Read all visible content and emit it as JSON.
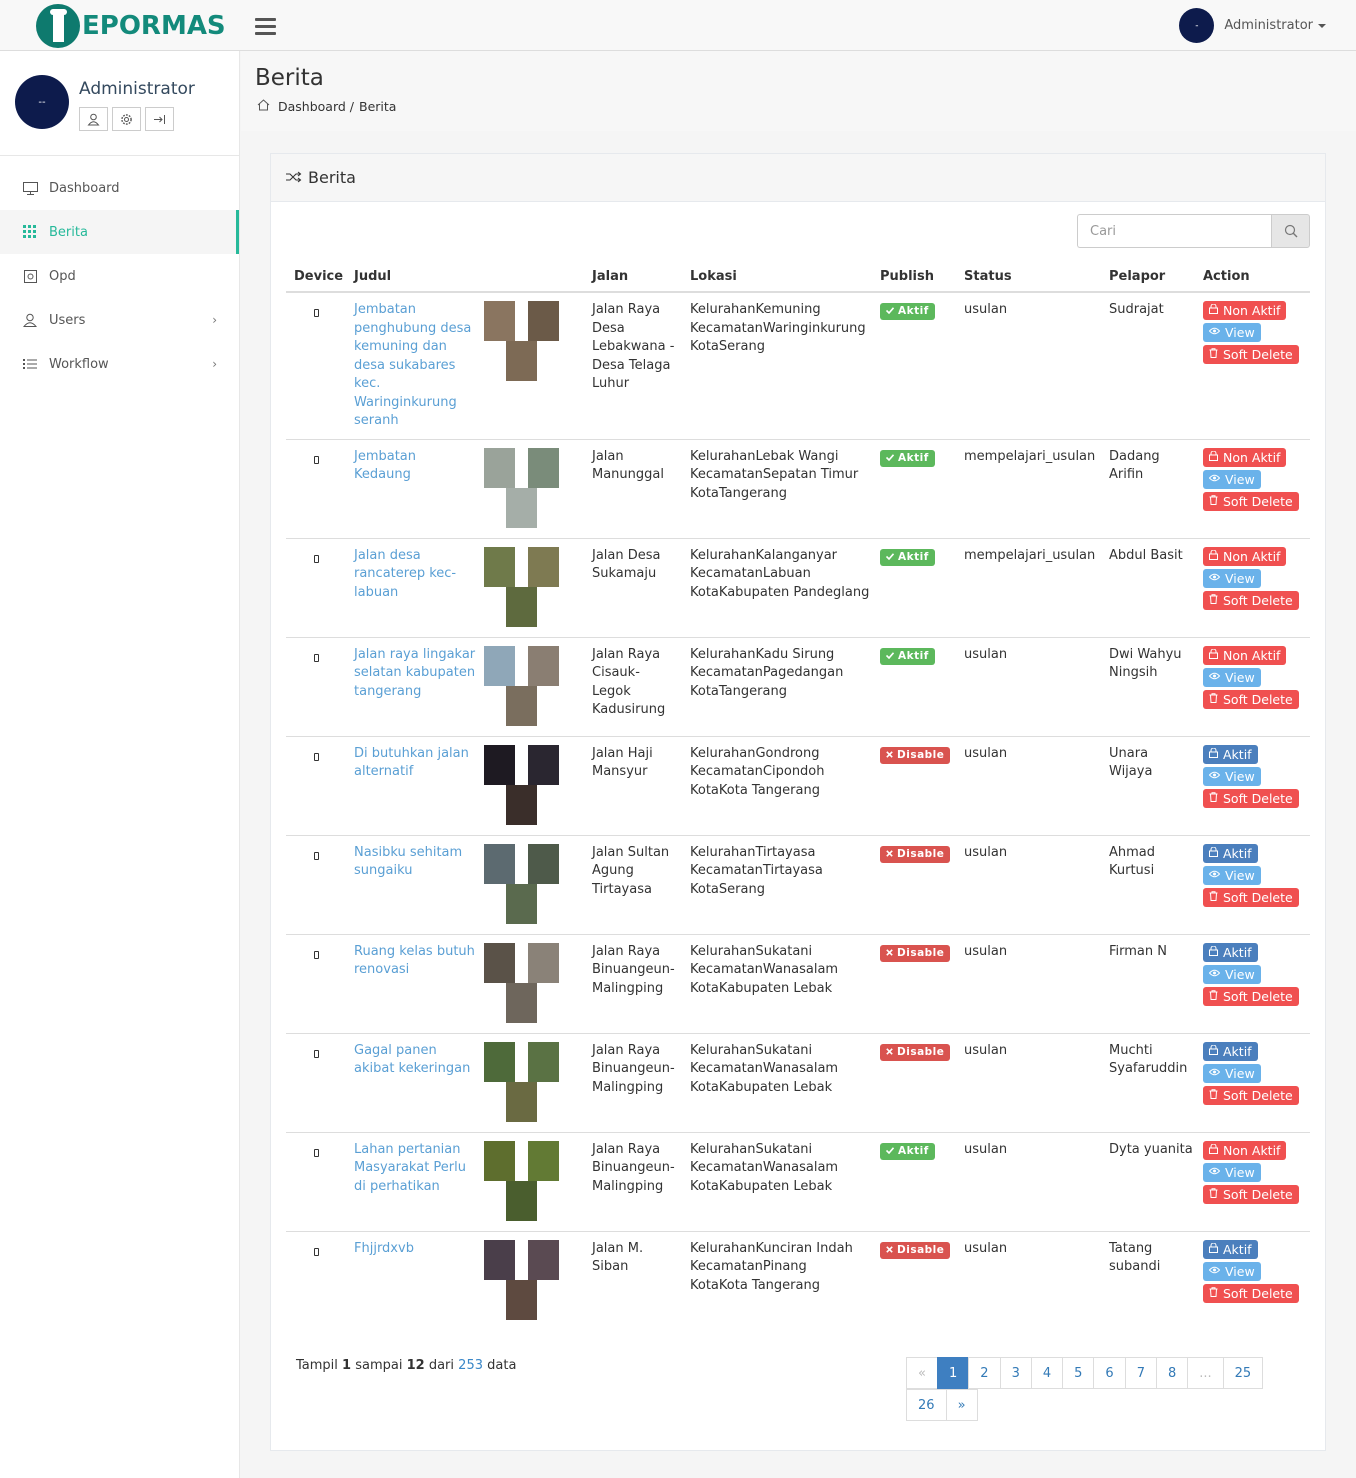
{
  "app": {
    "brand": "EPORMAS",
    "user": "Administrator",
    "avatar_initial": "-"
  },
  "sidebar": {
    "profile_name": "Administrator",
    "avatar_initial": "--",
    "items": [
      {
        "label": "Dashboard",
        "icon": "monitor-icon",
        "active": false
      },
      {
        "label": "Berita",
        "icon": "grid-icon",
        "active": true
      },
      {
        "label": "Opd",
        "icon": "settings-square-icon",
        "active": false
      },
      {
        "label": "Users",
        "icon": "user-icon",
        "active": false,
        "chevron": "›"
      },
      {
        "label": "Workflow",
        "icon": "list-icon",
        "active": false,
        "chevron": "›"
      }
    ]
  },
  "page": {
    "title": "Berita",
    "breadcrumb": [
      "Dashboard /",
      "Berita"
    ]
  },
  "panel": {
    "title": "Berita",
    "search_placeholder": "Cari"
  },
  "table": {
    "headers": [
      "Device",
      "Judul",
      "",
      "Jalan",
      "Lokasi",
      "Publish",
      "Status",
      "Pelapor",
      "Action"
    ],
    "rows": [
      {
        "judul": "Jembatan penghubung desa kemuning dan desa sukabares kec. Waringinkurung seranh",
        "jalan": "Jalan Raya Desa Lebakwana - Desa Telaga Luhur",
        "lokasi": [
          "KelurahanKemuning",
          "KecamatanWaringinkurung",
          "KotaSerang"
        ],
        "publish": "Aktif",
        "status": "usulan",
        "pelapor": "Sudrajat",
        "toggle": "Non Aktif",
        "thumbs": [
          "#8a7560",
          "#6b5a48",
          "#7d6a55"
        ]
      },
      {
        "judul": "Jembatan Kedaung",
        "jalan": "Jalan Manunggal",
        "lokasi": [
          "KelurahanLebak Wangi",
          "KecamatanSepatan Timur",
          "KotaTangerang"
        ],
        "publish": "Aktif",
        "status": "mempelajari_usulan",
        "pelapor": "Dadang Arifin",
        "toggle": "Non Aktif",
        "thumbs": [
          "#9aa39a",
          "#7a8c7a",
          "#a5aea8"
        ]
      },
      {
        "judul": "Jalan desa rancaterep kec- labuan",
        "jalan": "Jalan Desa Sukamaju",
        "lokasi": [
          "KelurahanKalanganyar",
          "KecamatanLabuan",
          "KotaKabupaten Pandeglang"
        ],
        "publish": "Aktif",
        "status": "mempelajari_usulan",
        "pelapor": "Abdul Basit",
        "toggle": "Non Aktif",
        "thumbs": [
          "#6f7a4a",
          "#7e7a52",
          "#5e6a3e"
        ]
      },
      {
        "judul": "Jalan raya lingakar selatan kabupaten tangerang",
        "jalan": "Jalan Raya Cisauk- Legok Kadusirung",
        "lokasi": [
          "KelurahanKadu Sirung",
          "KecamatanPagedangan",
          "KotaTangerang"
        ],
        "publish": "Aktif",
        "status": "usulan",
        "pelapor": "Dwi Wahyu Ningsih",
        "toggle": "Non Aktif",
        "thumbs": [
          "#8fa7b8",
          "#8a7e72",
          "#7a6e5e"
        ]
      },
      {
        "judul": "Di butuhkan jalan alternatif",
        "jalan": "Jalan Haji Mansyur",
        "lokasi": [
          "KelurahanGondrong",
          "KecamatanCipondoh",
          "KotaKota Tangerang"
        ],
        "publish": "Disable",
        "status": "usulan",
        "pelapor": "Unara Wijaya",
        "toggle": "Aktif",
        "thumbs": [
          "#1e1a22",
          "#2a2630",
          "#3a2e2a"
        ]
      },
      {
        "judul": "Nasibku sehitam sungaiku",
        "jalan": "Jalan Sultan Agung Tirtayasa",
        "lokasi": [
          "KelurahanTirtayasa",
          "KecamatanTirtayasa",
          "KotaSerang"
        ],
        "publish": "Disable",
        "status": "usulan",
        "pelapor": "Ahmad Kurtusi",
        "toggle": "Aktif",
        "thumbs": [
          "#5c6a70",
          "#4e5a4a",
          "#5a6a4e"
        ]
      },
      {
        "judul": "Ruang kelas butuh renovasi",
        "jalan": "Jalan Raya Binuangeun- Malingping",
        "lokasi": [
          "KelurahanSukatani",
          "KecamatanWanasalam",
          "KotaKabupaten Lebak"
        ],
        "publish": "Disable",
        "status": "usulan",
        "pelapor": "Firman N",
        "toggle": "Aktif",
        "thumbs": [
          "#5a5248",
          "#8a8278",
          "#6e665c"
        ]
      },
      {
        "judul": "Gagal panen akibat kekeringan",
        "jalan": "Jalan Raya Binuangeun- Malingping",
        "lokasi": [
          "KelurahanSukatani",
          "KecamatanWanasalam",
          "KotaKabupaten Lebak"
        ],
        "publish": "Disable",
        "status": "usulan",
        "pelapor": "Muchti Syafaruddin",
        "toggle": "Aktif",
        "thumbs": [
          "#4e6a3a",
          "#5a7244",
          "#6a6a42"
        ]
      },
      {
        "judul": "Lahan pertanian Masyarakat Perlu di perhatikan",
        "jalan": "Jalan Raya Binuangeun- Malingping",
        "lokasi": [
          "KelurahanSukatani",
          "KecamatanWanasalam",
          "KotaKabupaten Lebak"
        ],
        "publish": "Aktif",
        "status": "usulan",
        "pelapor": "Dyta yuanita",
        "toggle": "Non Aktif",
        "thumbs": [
          "#5e6e2e",
          "#627a34",
          "#4a5e2e"
        ]
      },
      {
        "judul": "Fhjjrdxvb",
        "jalan": "Jalan M. Siban",
        "lokasi": [
          "KelurahanKunciran Indah",
          "KecamatanPinang",
          "KotaKota Tangerang"
        ],
        "publish": "Disable",
        "status": "usulan",
        "pelapor": "Tatang subandi",
        "toggle": "Aktif",
        "thumbs": [
          "#4a3e4a",
          "#5a4a52",
          "#5e4a40"
        ]
      }
    ],
    "view_label": "View",
    "delete_label": "Soft Delete"
  },
  "footer": {
    "info_prefix": "Tampil",
    "from": "1",
    "mid": "sampai",
    "to": "12",
    "of": "dari",
    "total": "253",
    "suffix": "data",
    "pages": [
      "«",
      "1",
      "2",
      "3",
      "4",
      "5",
      "6",
      "7",
      "8",
      "...",
      "25"
    ],
    "pages_row2": [
      "26",
      "»"
    ]
  },
  "colors": {
    "brand": "#138a7b",
    "accent": "#26b99a",
    "link": "#5a9fd4",
    "success": "#5cb85c",
    "danger": "#d9534f"
  }
}
